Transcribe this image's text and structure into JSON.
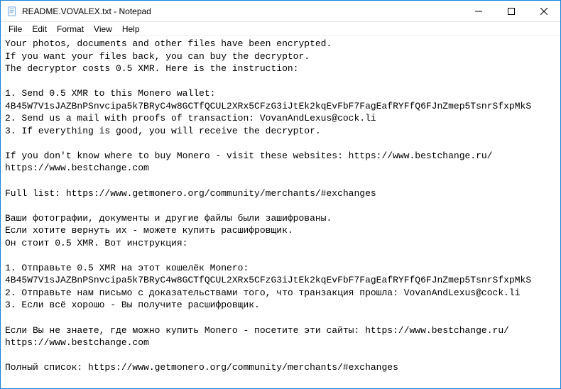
{
  "titlebar": {
    "title": "README.VOVALEX.txt - Notepad"
  },
  "menubar": {
    "file": "File",
    "edit": "Edit",
    "format": "Format",
    "view": "View",
    "help": "Help"
  },
  "content": {
    "line1": "Your photos, documents and other files have been encrypted.",
    "line2": "If you want your files back, you can buy the decryptor.",
    "line3": "The decryptor costs 0.5 XMR. Here is the instruction:",
    "blank1": "",
    "line4": "1. Send 0.5 XMR to this Monero wallet:",
    "line5": "4B45W7V1sJAZBnPSnvcipa5k7BRyC4w8GCTfQCUL2XRx5CFzG3iJtEk2kqEvFbF7FagEafRYFfQ6FJnZmep5TsnrSfxpMkS",
    "line6": "2. Send us a mail with proofs of transaction: VovanAndLexus@cock.li",
    "line7": "3. If everything is good, you will receive the decryptor.",
    "blank2": "",
    "line8": "If you don't know where to buy Monero - visit these websites: https://www.bestchange.ru/",
    "line9": "https://www.bestchange.com",
    "blank3": "",
    "line10": "Full list: https://www.getmonero.org/community/merchants/#exchanges",
    "blank4": "",
    "line11": "Ваши фотографии, документы и другие файлы были зашифрованы.",
    "line12": "Если хотите вернуть их - можете купить расшифровщик.",
    "line13": "Он стоит 0.5 XMR. Вот инструкция:",
    "blank5": "",
    "line14": "1. Отправьте 0.5 XMR на этот кошелёк Monero:",
    "line15": "4B45W7V1sJAZBnPSnvcipa5k7BRyC4w8GCTfQCUL2XRx5CFzG3iJtEk2kqEvFbF7FagEafRYFfQ6FJnZmep5TsnrSfxpMkS",
    "line16": "2. Отправьте нам письмо с доказательствами того, что транзакция прошла: VovanAndLexus@cock.li",
    "line17": "3. Если всё хорошо - Вы получите расшифровщик.",
    "blank6": "",
    "line18": "Если Вы не знаете, где можно купить Monero - посетите эти сайты: https://www.bestchange.ru/",
    "line19": "https://www.bestchange.com",
    "blank7": "",
    "line20": "Полный список: https://www.getmonero.org/community/merchants/#exchanges"
  }
}
